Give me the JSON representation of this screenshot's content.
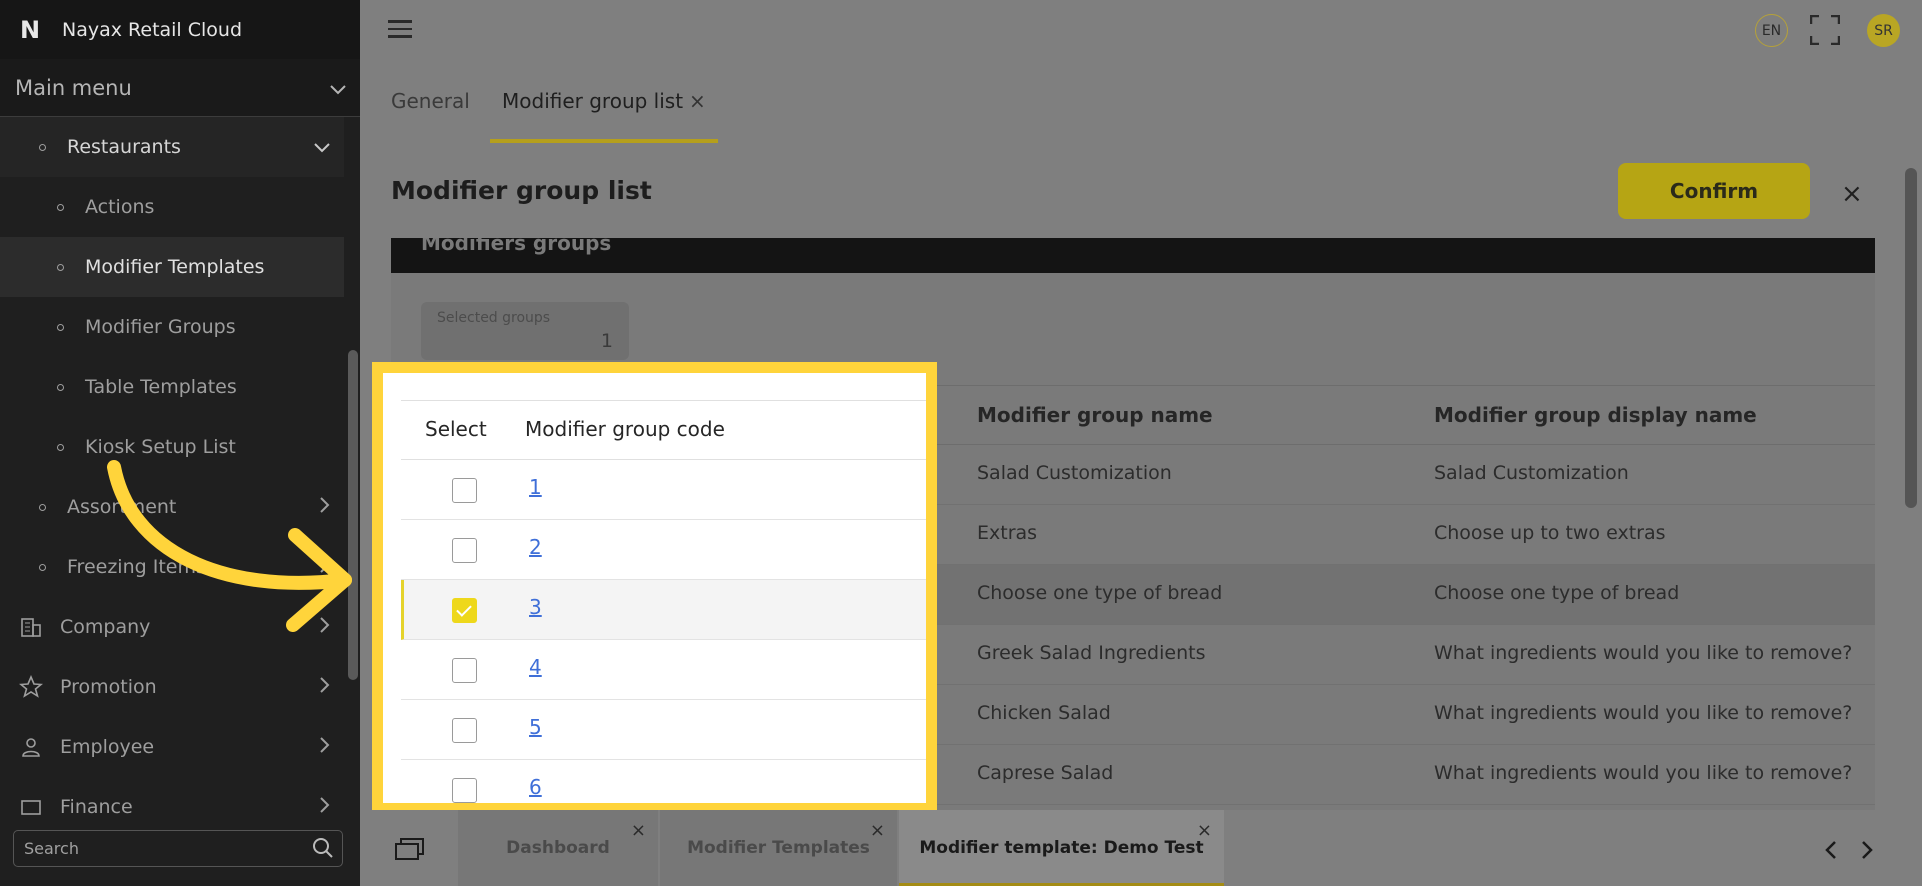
{
  "app": {
    "logo": "N",
    "title": "Nayax Retail Cloud"
  },
  "sidebar": {
    "main_menu_label": "Main menu",
    "items": [
      {
        "label": "Restaurants",
        "level": 1,
        "state": "open"
      },
      {
        "label": "Actions",
        "level": 2
      },
      {
        "label": "Modifier Templates",
        "level": 2,
        "state": "active"
      },
      {
        "label": "Modifier Groups",
        "level": 2
      },
      {
        "label": "Table Templates",
        "level": 2
      },
      {
        "label": "Kiosk Setup List",
        "level": 2
      },
      {
        "label": "Assortment",
        "level": 1
      },
      {
        "label": "Freezing Items",
        "level": 1
      },
      {
        "label": "Company",
        "level": 0,
        "icon": "building-icon"
      },
      {
        "label": "Promotion",
        "level": 0,
        "icon": "star-icon"
      },
      {
        "label": "Employee",
        "level": 0,
        "icon": "person-icon"
      },
      {
        "label": "Finance",
        "level": 0,
        "icon": "finance-icon"
      }
    ],
    "search_placeholder": "Search"
  },
  "topbar": {
    "language": "EN",
    "user_initials": "SR"
  },
  "tabs": [
    {
      "label": "General"
    },
    {
      "label": "Modifier group list",
      "close": "×"
    }
  ],
  "panel": {
    "title": "Modifier group list",
    "confirm_label": "Confirm",
    "close": "×",
    "section_title": "Modifiers groups",
    "selected_groups_label": "Selected groups",
    "selected_groups_value": "1"
  },
  "table": {
    "columns": [
      "Select",
      "Modifier group code",
      "Modifier group name",
      "Modifier group display name"
    ],
    "rows": [
      {
        "code": "1",
        "name": "Salad Customization",
        "display": "Salad Customization",
        "checked": false
      },
      {
        "code": "2",
        "name": "Extras",
        "display": "Choose up to two extras",
        "checked": false
      },
      {
        "code": "3",
        "name": "Choose one type of bread",
        "display": "Choose one type of bread",
        "checked": true
      },
      {
        "code": "4",
        "name": "Greek Salad Ingredients",
        "display": "What ingredients would you like to remove?",
        "checked": false
      },
      {
        "code": "5",
        "name": "Chicken Salad",
        "display": "What ingredients would you like to remove?",
        "checked": false
      },
      {
        "code": "6",
        "name": "Caprese Salad",
        "display": "What ingredients would you like to remove?",
        "checked": false
      }
    ]
  },
  "bottom_tabs": [
    {
      "label": "Dashboard",
      "close": "×"
    },
    {
      "label": "Modifier Templates",
      "close": "×"
    },
    {
      "label": "Modifier template: Demo Test",
      "close": "×"
    }
  ],
  "colors": {
    "accent_yellow": "#ffd43b",
    "link_blue": "#3f6fd8",
    "sidebar_bg": "#1f1f1f",
    "confirm_yellow": "#e6cf12"
  }
}
